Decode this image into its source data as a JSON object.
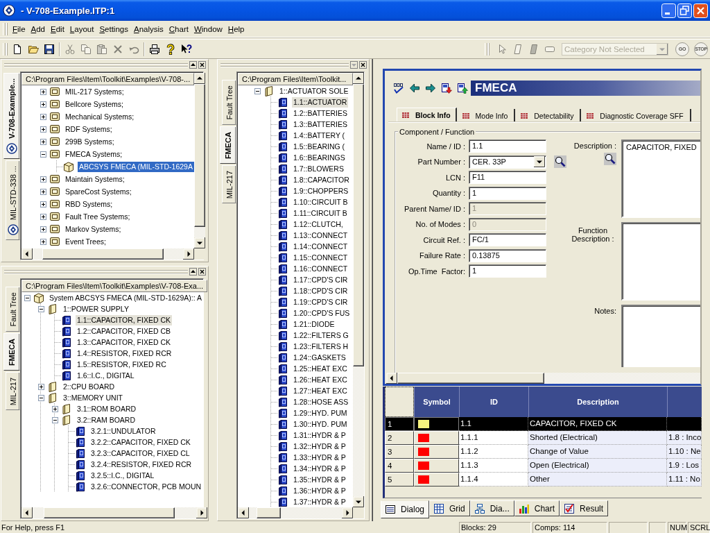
{
  "window": {
    "title": "- V-708-Example.ITP:1"
  },
  "menu": [
    "File",
    "Add",
    "Edit",
    "Layout",
    "Settings",
    "Analysis",
    "Chart",
    "Window",
    "Help"
  ],
  "toolbar": {
    "groups": [
      [
        {
          "kind": "new",
          "disabled": false
        },
        {
          "kind": "open",
          "disabled": false
        },
        {
          "kind": "save",
          "disabled": false
        }
      ],
      [
        {
          "kind": "cut",
          "disabled": true
        },
        {
          "kind": "copy",
          "disabled": true
        },
        {
          "kind": "paste",
          "disabled": true
        },
        {
          "kind": "delete",
          "disabled": true
        },
        {
          "kind": "undo",
          "disabled": true
        }
      ],
      [
        {
          "kind": "print",
          "disabled": false
        },
        {
          "kind": "help",
          "disabled": false
        },
        {
          "kind": "context-help",
          "disabled": false
        }
      ]
    ]
  },
  "run_toolbar": {
    "tools": [
      {
        "kind": "pointer",
        "disabled": true
      },
      {
        "kind": "page",
        "disabled": true
      },
      {
        "kind": "page-filled",
        "disabled": true
      },
      {
        "kind": "block",
        "disabled": true
      }
    ],
    "category": {
      "value": "Category Not Selected",
      "disabled": true
    },
    "buttons": [
      {
        "label": "GO",
        "disabled": true
      },
      {
        "label": "STOP",
        "disabled": true
      }
    ]
  },
  "panes": [
    {
      "tabs": [
        {
          "label": "V-708-Example...",
          "kind": "project",
          "selected": true
        },
        {
          "label": "MIL-STD-338 ...",
          "kind": "project",
          "selected": false
        }
      ],
      "dock_button": {
        "kind": "up",
        "disabled": false
      },
      "path": "C:\\Program Files\\Item\\Toolkit\\Examples\\V-708-...",
      "focused": true,
      "tree": [
        {
          "label": "MIL-217 Systems;",
          "kind": "system",
          "expanded": false,
          "selected": false
        },
        {
          "label": "Bellcore Systems;",
          "kind": "system",
          "expanded": false,
          "selected": false
        },
        {
          "label": "Mechanical Systems;",
          "kind": "system",
          "expanded": false,
          "selected": false
        },
        {
          "label": "RDF Systems;",
          "kind": "system",
          "expanded": false,
          "selected": false
        },
        {
          "label": "299B Systems;",
          "kind": "system",
          "expanded": false,
          "selected": false
        },
        {
          "label": "FMECA Systems;",
          "kind": "system",
          "expanded": true,
          "selected": false,
          "children": [
            {
              "label": "ABCSYS FMECA (MIL-STD-1629A",
              "kind": "model",
              "selected": true
            }
          ]
        },
        {
          "label": "Maintain Systems;",
          "kind": "system",
          "expanded": false,
          "selected": false
        },
        {
          "label": "SpareCost Systems;",
          "kind": "system",
          "expanded": false,
          "selected": false
        },
        {
          "label": "RBD Systems;",
          "kind": "system",
          "expanded": false,
          "selected": false
        },
        {
          "label": "Fault Tree Systems;",
          "kind": "system",
          "expanded": false,
          "selected": false
        },
        {
          "label": "Markov Systems;",
          "kind": "system",
          "expanded": false,
          "selected": false
        },
        {
          "label": "Event Trees;",
          "kind": "system",
          "expanded": false,
          "selected": false
        }
      ]
    },
    {
      "tabs": [
        {
          "label": "Fault Tree",
          "kind": "view",
          "selected": false
        },
        {
          "label": "FMECA",
          "kind": "view",
          "selected": true
        },
        {
          "label": "MIL-217",
          "kind": "view",
          "selected": false
        }
      ],
      "dock_button": {
        "kind": "up",
        "disabled": false
      },
      "path": "C:\\Program Files\\Item\\Toolkit\\Examples\\V-708-Exa...",
      "focused": false,
      "tree": [
        {
          "label": "System ABCSYS FMECA (MIL-STD-1629A):: A",
          "kind": "model",
          "expanded": true,
          "selected": false,
          "children": [
            {
              "label": "1::POWER SUPPLY",
              "kind": "assembly",
              "expanded": true,
              "selected": false,
              "children": [
                {
                  "label": "1.1::CAPACITOR, FIXED CK",
                  "kind": "part",
                  "selected": true
                },
                {
                  "label": "1.2::CAPACITOR, FIXED CB",
                  "kind": "part",
                  "selected": false
                },
                {
                  "label": "1.3::CAPACITOR, FIXED CK",
                  "kind": "part",
                  "selected": false
                },
                {
                  "label": "1.4::RESISTOR, FIXED RCR",
                  "kind": "part",
                  "selected": false
                },
                {
                  "label": "1.5::RESISTOR, FIXED RC",
                  "kind": "part",
                  "selected": false
                },
                {
                  "label": "1.6::I.C., DIGITAL",
                  "kind": "part",
                  "selected": false
                }
              ]
            },
            {
              "label": "2::CPU BOARD",
              "kind": "assembly",
              "expanded": false,
              "selected": false
            },
            {
              "label": "3::MEMORY UNIT",
              "kind": "assembly",
              "expanded": true,
              "selected": false,
              "children": [
                {
                  "label": "3.1::ROM BOARD",
                  "kind": "assembly",
                  "expanded": false,
                  "selected": false
                },
                {
                  "label": "3.2::RAM BOARD",
                  "kind": "assembly",
                  "expanded": true,
                  "selected": false,
                  "children": [
                    {
                      "label": "3.2.1::UNDULATOR",
                      "kind": "part",
                      "selected": false
                    },
                    {
                      "label": "3.2.2::CAPACITOR, FIXED CK",
                      "kind": "part",
                      "selected": false
                    },
                    {
                      "label": "3.2.3::CAPACITOR, FIXED CL",
                      "kind": "part",
                      "selected": false
                    },
                    {
                      "label": "3.2.4::RESISTOR, FIXED RCR",
                      "kind": "part",
                      "selected": false
                    },
                    {
                      "label": "3.2.5::I.C., DIGITAL",
                      "kind": "part",
                      "selected": false
                    },
                    {
                      "label": "3.2.6::CONNECTOR, PCB MOUN",
                      "kind": "part",
                      "selected": false
                    }
                  ]
                }
              ]
            }
          ]
        }
      ]
    },
    {
      "tabs": [
        {
          "label": "Fault Tree",
          "kind": "view",
          "selected": false
        },
        {
          "label": "FMECA",
          "kind": "view",
          "selected": true
        },
        {
          "label": "MIL-217",
          "kind": "view",
          "selected": false
        }
      ],
      "dock_button": {
        "kind": "down",
        "disabled": true
      },
      "path": "C:\\Program Files\\Item\\Toolkit...",
      "focused": false,
      "tree": [
        {
          "label": "1::ACTUATOR SOLE",
          "kind": "assembly",
          "expanded": true,
          "selected": false,
          "children": [
            {
              "label": "1.1::ACTUATOR",
              "kind": "part",
              "selected": true
            },
            {
              "label": "1.2::BATTERIES",
              "kind": "part",
              "selected": false
            },
            {
              "label": "1.3::BATTERIES",
              "kind": "part",
              "selected": false
            },
            {
              "label": "1.4::BATTERY (",
              "kind": "part",
              "selected": false
            },
            {
              "label": "1.5::BEARING (",
              "kind": "part",
              "selected": false
            },
            {
              "label": "1.6::BEARINGS",
              "kind": "part",
              "selected": false
            },
            {
              "label": "1.7::BLOWERS",
              "kind": "part",
              "selected": false
            },
            {
              "label": "1.8::CAPACITOR",
              "kind": "part",
              "selected": false
            },
            {
              "label": "1.9::CHOPPERS",
              "kind": "part",
              "selected": false
            },
            {
              "label": "1.10::CIRCUIT B",
              "kind": "part",
              "selected": false
            },
            {
              "label": "1.11::CIRCUIT B",
              "kind": "part",
              "selected": false
            },
            {
              "label": "1.12::CLUTCH,",
              "kind": "part",
              "selected": false
            },
            {
              "label": "1.13::CONNECT",
              "kind": "part",
              "selected": false
            },
            {
              "label": "1.14::CONNECT",
              "kind": "part",
              "selected": false
            },
            {
              "label": "1.15::CONNECT",
              "kind": "part",
              "selected": false
            },
            {
              "label": "1.16::CONNECT",
              "kind": "part",
              "selected": false
            },
            {
              "label": "1.17::CPD'S CIR",
              "kind": "part",
              "selected": false
            },
            {
              "label": "1.18::CPD'S CIR",
              "kind": "part",
              "selected": false
            },
            {
              "label": "1.19::CPD'S CIR",
              "kind": "part",
              "selected": false
            },
            {
              "label": "1.20::CPD'S FUS",
              "kind": "part",
              "selected": false
            },
            {
              "label": "1.21::DIODE",
              "kind": "part",
              "selected": false
            },
            {
              "label": "1.22::FILTERS G",
              "kind": "part",
              "selected": false
            },
            {
              "label": "1.23::FILTERS H",
              "kind": "part",
              "selected": false
            },
            {
              "label": "1.24::GASKETS",
              "kind": "part",
              "selected": false
            },
            {
              "label": "1.25::HEAT EXC",
              "kind": "part",
              "selected": false
            },
            {
              "label": "1.26::HEAT EXC",
              "kind": "part",
              "selected": false
            },
            {
              "label": "1.27::HEAT EXC",
              "kind": "part",
              "selected": false
            },
            {
              "label": "1.28::HOSE ASS",
              "kind": "part",
              "selected": false
            },
            {
              "label": "1.29::HYD. PUM",
              "kind": "part",
              "selected": false
            },
            {
              "label": "1.30::HYD. PUM",
              "kind": "part",
              "selected": false
            },
            {
              "label": "1.31::HYDR & P",
              "kind": "part",
              "selected": false
            },
            {
              "label": "1.32::HYDR & P",
              "kind": "part",
              "selected": false
            },
            {
              "label": "1.33::HYDR & P",
              "kind": "part",
              "selected": false
            },
            {
              "label": "1.34::HYDR & P",
              "kind": "part",
              "selected": false
            },
            {
              "label": "1.35::HYDR & P",
              "kind": "part",
              "selected": false
            },
            {
              "label": "1.36::HYDR & P",
              "kind": "part",
              "selected": false
            },
            {
              "label": "1.37::HYDR & P",
              "kind": "part",
              "selected": false
            }
          ]
        }
      ]
    }
  ],
  "dialog": {
    "title": "FMECA",
    "tabs": [
      {
        "label": "Block Info",
        "selected": true
      },
      {
        "label": "Mode Info",
        "selected": false
      },
      {
        "label": "Detectability",
        "selected": false
      },
      {
        "label": "Diagnostic Coverage SFF",
        "selected": false
      }
    ],
    "group_title": "Component / Function",
    "fields": [
      {
        "label": "Name / ID :",
        "value": "1.1",
        "kind": "text",
        "disabled": false
      },
      {
        "label": "Part Number :",
        "value": "CER. 33P",
        "kind": "dropdown",
        "disabled": false
      },
      {
        "label": "LCN :",
        "value": "F11",
        "kind": "text",
        "disabled": false
      },
      {
        "label": "Quantity :",
        "value": "1",
        "kind": "text",
        "disabled": false
      },
      {
        "label": "Parent Name/ ID :",
        "value": "1",
        "kind": "text",
        "disabled": true
      },
      {
        "label": "No. of Modes :",
        "value": "0",
        "kind": "text",
        "disabled": true
      },
      {
        "label": "Circuit Ref. :",
        "value": "FC/1",
        "kind": "text",
        "disabled": false
      },
      {
        "label": "Failure Rate :",
        "value": "0.13875",
        "kind": "text",
        "disabled": false
      },
      {
        "label": "Op.Time  Factor:",
        "value": "1",
        "kind": "text",
        "disabled": false
      }
    ],
    "description": {
      "label": "Description :",
      "value": "CAPACITOR, FIXED"
    },
    "function_description": {
      "label": "Function Description :"
    },
    "notes": {
      "label": "Notes:"
    }
  },
  "grid": {
    "columns": [
      "Symbol",
      "ID",
      "Description"
    ],
    "rows": [
      {
        "number": "1",
        "color": "#f8f480",
        "id": "1.1",
        "description": "CAPACITOR, FIXED CK",
        "selected": true
      },
      {
        "number": "2",
        "color": "#ff0000",
        "id": "1.1.1",
        "description": "Shorted (Electrical)",
        "column_5": "1.8 : Inco",
        "selected": false
      },
      {
        "number": "3",
        "color": "#ff0000",
        "id": "1.1.2",
        "description": "Change of Value",
        "column_5": "1.10 : Ne",
        "selected": false
      },
      {
        "number": "4",
        "color": "#ff0000",
        "id": "1.1.3",
        "description": "Open (Electrical)",
        "column_5": "1.9 : Los",
        "selected": false
      },
      {
        "number": "5",
        "color": "#ff0000",
        "id": "1.1.4",
        "description": "Other",
        "column_5": "1.11 : No",
        "selected": false
      }
    ]
  },
  "view_tabs": [
    {
      "label": "Dialog",
      "kind": "dialog",
      "selected": true
    },
    {
      "label": "Grid",
      "kind": "grid",
      "selected": false
    },
    {
      "label": "Dia...",
      "kind": "diagram",
      "selected": false
    },
    {
      "label": "Chart",
      "kind": "chart",
      "selected": false
    },
    {
      "label": "Result",
      "kind": "result",
      "selected": false
    }
  ],
  "status_bar": {
    "message": "For Help, press F1",
    "panels": [
      "Blocks: 29",
      "Comps: 114"
    ],
    "indicators": [
      "NUM",
      "SCRL"
    ]
  }
}
